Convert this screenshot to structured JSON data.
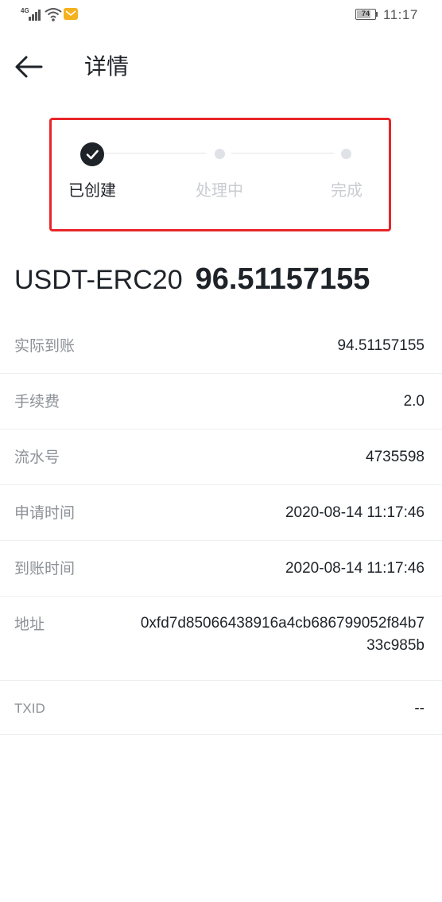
{
  "status_bar": {
    "network": "4G",
    "battery": "74",
    "time": "11:17",
    "icons": [
      "signal-icon",
      "wifi-icon",
      "mail-notification-icon",
      "battery-icon"
    ]
  },
  "header": {
    "back_icon": "arrow-left-icon",
    "title": "详情"
  },
  "stepper": {
    "steps": [
      {
        "label": "已创建",
        "state": "done"
      },
      {
        "label": "处理中",
        "state": "pending"
      },
      {
        "label": "完成",
        "state": "pending"
      }
    ],
    "active_color": "#1e2329",
    "inactive_color": "#c9ccd1",
    "highlight_border_color": "#e8262a"
  },
  "summary": {
    "coin": "USDT-ERC20",
    "amount": "96.51157155"
  },
  "details": [
    {
      "label": "实际到账",
      "value": "94.51157155"
    },
    {
      "label": "手续费",
      "value": "2.0"
    },
    {
      "label": "流水号",
      "value": "4735598"
    },
    {
      "label": "申请时间",
      "value": "2020-08-14 11:17:46"
    },
    {
      "label": "到账时间",
      "value": "2020-08-14 11:17:46"
    },
    {
      "label": "地址",
      "value": "0xfd7d85066438916a4cb686799052f84b733c985b"
    },
    {
      "label": "TXID",
      "value": "--"
    }
  ]
}
